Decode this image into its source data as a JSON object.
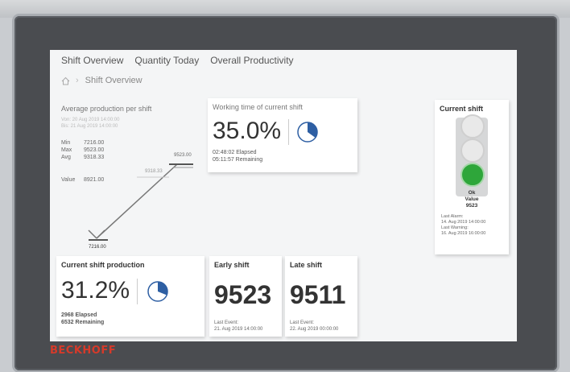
{
  "nav": [
    "Shift Overview",
    "Quantity Today",
    "Overall Productivity"
  ],
  "breadcrumb": "Shift Overview",
  "avg": {
    "title": "Average production per shift",
    "date_start": "Von: 20 Aug 2019 14:00:00",
    "date_end": "Bis: 21 Aug 2019 14:00:00",
    "min_label": "Min",
    "min": "7216.00",
    "max_label": "Max",
    "max": "9523.00",
    "avg_label": "Avg",
    "avg": "9318.33",
    "value_label": "Value",
    "value": "8921.00",
    "peak_label": "9523.00",
    "mid_label": "9318.33",
    "low_label": "7216.00"
  },
  "work": {
    "title": "Working time of current shift",
    "percent": "35.0%",
    "elapsed": "02:48:02 Elapsed",
    "remaining": "05:11:57 Remaining",
    "pie_fraction": 0.35
  },
  "current": {
    "title": "Current shift",
    "state": "Ok",
    "value_label": "Value",
    "value": "9523",
    "last_alarm_label": "Last Alarm:",
    "last_alarm": "14. Aug 2019 14:00:00",
    "last_warning_label": "Last Warning:",
    "last_warning": "16. Aug 2019 16:00:00",
    "active_light": "green"
  },
  "production": {
    "title": "Current shift production",
    "percent": "31.2%",
    "elapsed": "2968 Elapsed",
    "remaining": "6532 Remaining",
    "pie_fraction": 0.312
  },
  "early": {
    "title": "Early shift",
    "value": "9523",
    "last_event_label": "Last Event:",
    "last_event": "21. Aug 2019 14:00:00"
  },
  "late": {
    "title": "Late shift",
    "value": "9511",
    "last_event_label": "Last Event:",
    "last_event": "22. Aug 2019 00:00:00"
  },
  "brand": "BECKHOFF",
  "colors": {
    "accent": "#2e5fa3",
    "green": "#2ea63a",
    "brand": "#d63a2a"
  }
}
